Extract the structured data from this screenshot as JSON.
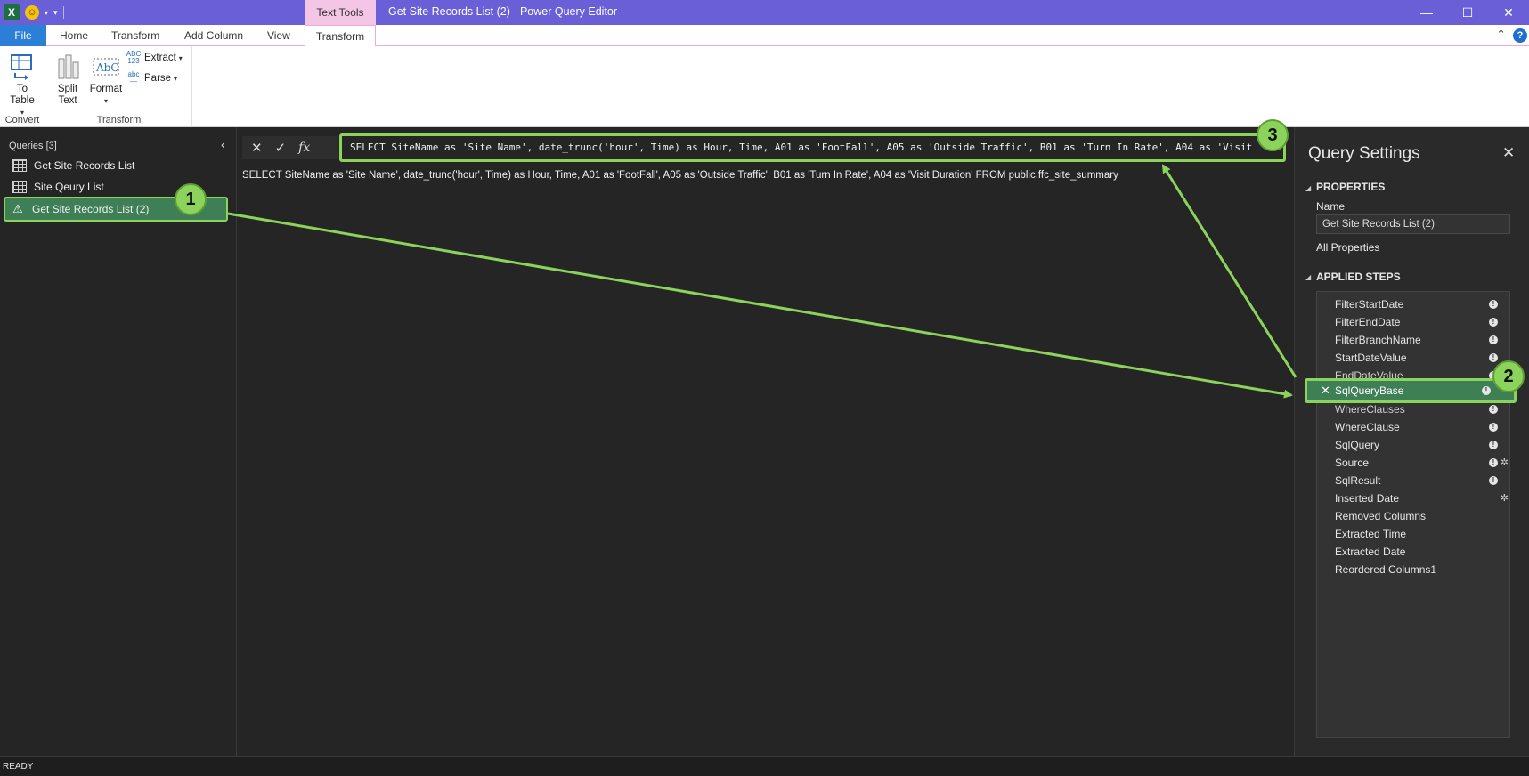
{
  "titlebar": {
    "app_icon": "X",
    "smiley_icon": "smiley-face-icon",
    "context_tab": "Text Tools",
    "window_title": "Get Site Records List (2) - Power Query Editor"
  },
  "ribbon_tabs": [
    "File",
    "Home",
    "Transform",
    "Add Column",
    "View",
    "Transform"
  ],
  "ribbon": {
    "to_table": "To\nTable",
    "convert_group": "Convert",
    "split_text": "Split\nText",
    "format": "Format",
    "extract": "Extract",
    "parse": "Parse",
    "transform_group": "Transform"
  },
  "queries": {
    "header": "Queries [3]",
    "items": [
      {
        "label": "Get Site Records List"
      },
      {
        "label": "Site Qeury List"
      },
      {
        "label": "Get Site Records List (2)"
      }
    ]
  },
  "formula_bar": {
    "value": "SELECT SiteName as 'Site Name', date_trunc('hour', Time) as Hour, Time, A01 as 'FootFall', A05 as 'Outside Traffic', B01 as 'Turn In Rate', A04 as 'Visit",
    "fx": "fx"
  },
  "preview": {
    "text": "SELECT SiteName as 'Site Name', date_trunc('hour', Time) as Hour, Time, A01 as 'FootFall', A05 as 'Outside Traffic', B01 as 'Turn In Rate', A04 as 'Visit Duration' FROM public.ffc_site_summary"
  },
  "settings": {
    "title": "Query Settings",
    "properties_title": "PROPERTIES",
    "name_label": "Name",
    "name_value": "Get Site Records List (2)",
    "all_properties": "All Properties",
    "applied_steps_title": "APPLIED STEPS",
    "steps": [
      {
        "label": "FilterStartDate"
      },
      {
        "label": "FilterEndDate"
      },
      {
        "label": "FilterBranchName"
      },
      {
        "label": "StartDateValue"
      },
      {
        "label": "EndDateValue"
      },
      {
        "label": "SqlQueryBase"
      },
      {
        "label": "WhereClauses"
      },
      {
        "label": "WhereClause"
      },
      {
        "label": "SqlQuery"
      },
      {
        "label": "Source"
      },
      {
        "label": "SqlResult"
      },
      {
        "label": "Inserted Date"
      },
      {
        "label": "Removed Columns"
      },
      {
        "label": "Extracted Time"
      },
      {
        "label": "Extracted Date"
      },
      {
        "label": "Reordered Columns1"
      }
    ]
  },
  "status": "READY",
  "annotations": [
    "1",
    "2",
    "3"
  ],
  "colors": {
    "title_bar": "#6a5fd6",
    "accent_green": "#8bd35a",
    "selection_green": "#3f7f56",
    "file_tab": "#2b7fd6"
  }
}
